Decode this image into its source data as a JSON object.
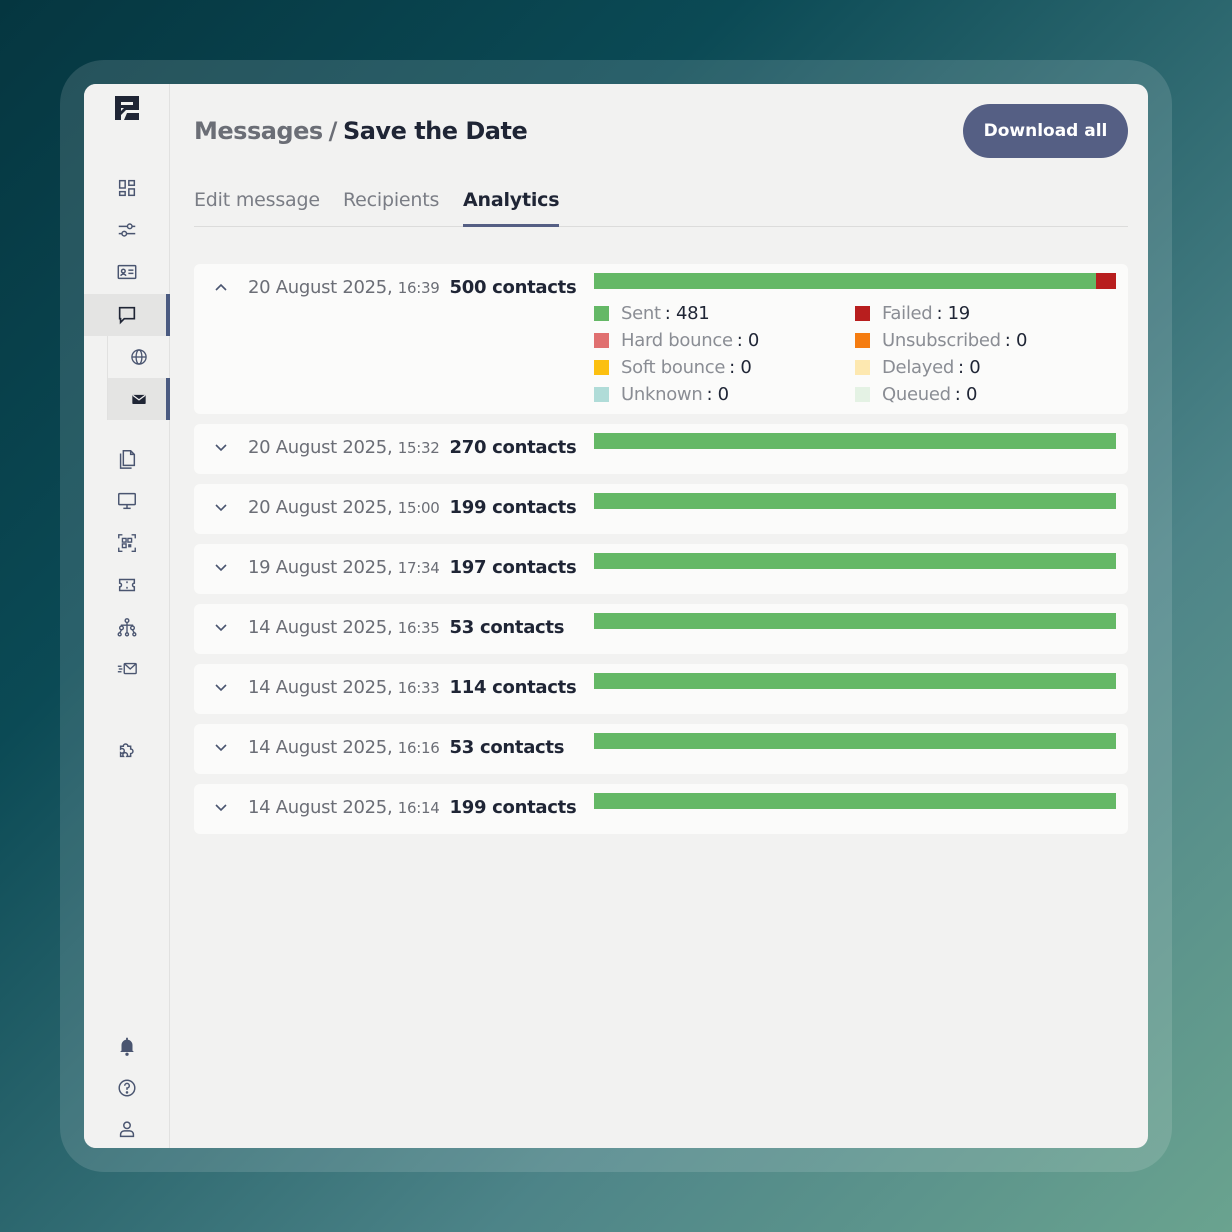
{
  "breadcrumb": {
    "parent": "Messages",
    "separator": "/",
    "current": "Save the Date"
  },
  "download_label": "Download all",
  "tabs": [
    {
      "label": "Edit message",
      "active": false
    },
    {
      "label": "Recipients",
      "active": false
    },
    {
      "label": "Analytics",
      "active": true
    }
  ],
  "colors": {
    "accent": "#555f84",
    "sent": "#64b866",
    "failed": "#b81e1e",
    "hard_bounce": "#e07070",
    "unsubscribed": "#f57c10",
    "soft_bounce": "#fcc010",
    "delayed": "#fde8b0",
    "unknown": "#b0dcd8",
    "queued": "#e4f2e4"
  },
  "sidebar": {
    "icons": [
      "dashboard-icon",
      "sliders-icon",
      "contact-card-icon",
      "chat-icon",
      "globe-icon",
      "mail-icon",
      "documents-icon",
      "monitor-icon",
      "qr-code-icon",
      "ticket-icon",
      "hierarchy-icon",
      "fast-mail-icon",
      "puzzle-icon",
      "bell-icon",
      "help-icon",
      "user-icon"
    ]
  },
  "runs": [
    {
      "date": "20 August 2025,",
      "time": "16:39",
      "contacts": "500 contacts",
      "expanded": true,
      "sent_fraction": 0.962,
      "failed_fraction": 0.038,
      "legend": [
        {
          "label": "Sent",
          "value": ": 481",
          "color": "#64b866"
        },
        {
          "label": "Failed",
          "value": ": 19",
          "color": "#b81e1e"
        },
        {
          "label": "Hard bounce",
          "value": ": 0",
          "color": "#e07070"
        },
        {
          "label": "Unsubscribed",
          "value": ": 0",
          "color": "#f57c10"
        },
        {
          "label": "Soft bounce",
          "value": ": 0",
          "color": "#fcc010"
        },
        {
          "label": "Delayed",
          "value": ": 0",
          "color": "#fde8b0"
        },
        {
          "label": "Unknown",
          "value": ": 0",
          "color": "#b0dcd8"
        },
        {
          "label": "Queued",
          "value": ": 0",
          "color": "#e4f2e4"
        }
      ]
    },
    {
      "date": "20 August 2025,",
      "time": "15:32",
      "contacts": "270 contacts",
      "expanded": false,
      "sent_fraction": 1,
      "failed_fraction": 0
    },
    {
      "date": "20 August 2025,",
      "time": "15:00",
      "contacts": "199 contacts",
      "expanded": false,
      "sent_fraction": 1,
      "failed_fraction": 0
    },
    {
      "date": "19 August 2025,",
      "time": "17:34",
      "contacts": "197 contacts",
      "expanded": false,
      "sent_fraction": 1,
      "failed_fraction": 0
    },
    {
      "date": "14 August 2025,",
      "time": "16:35",
      "contacts": "53 contacts",
      "expanded": false,
      "sent_fraction": 1,
      "failed_fraction": 0
    },
    {
      "date": "14 August 2025,",
      "time": "16:33",
      "contacts": "114 contacts",
      "expanded": false,
      "sent_fraction": 1,
      "failed_fraction": 0
    },
    {
      "date": "14 August 2025,",
      "time": "16:16",
      "contacts": "53 contacts",
      "expanded": false,
      "sent_fraction": 1,
      "failed_fraction": 0
    },
    {
      "date": "14 August 2025,",
      "time": "16:14",
      "contacts": "199 contacts",
      "expanded": false,
      "sent_fraction": 1,
      "failed_fraction": 0
    }
  ]
}
